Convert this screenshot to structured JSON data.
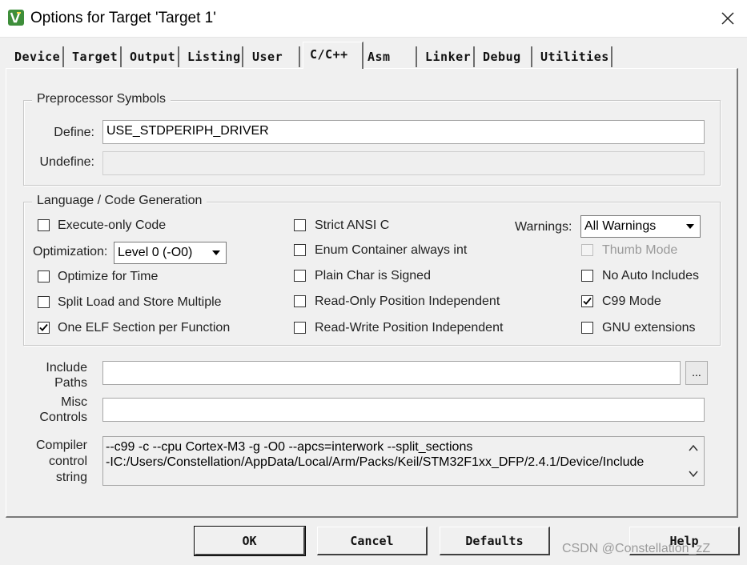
{
  "window": {
    "title": "Options for Target 'Target 1'",
    "close_glyph": "✕"
  },
  "tabs": [
    {
      "label": "Device"
    },
    {
      "label": "Target"
    },
    {
      "label": "Output"
    },
    {
      "label": "Listing"
    },
    {
      "label": "User"
    },
    {
      "label": "C/C++",
      "active": true
    },
    {
      "label": "Asm"
    },
    {
      "label": "Linker"
    },
    {
      "label": "Debug"
    },
    {
      "label": "Utilities"
    }
  ],
  "preprocessor": {
    "legend": "Preprocessor Symbols",
    "define_label": "Define:",
    "define_value": "USE_STDPERIPH_DRIVER",
    "undefine_label": "Undefine:",
    "undefine_value": ""
  },
  "language": {
    "legend": "Language / Code Generation",
    "execute_only": {
      "label": "Execute-only Code",
      "checked": false
    },
    "optimization_label": "Optimization:",
    "optimization_value": "Level 0 (-O0)",
    "optimize_for_time": {
      "label": "Optimize for Time",
      "checked": false
    },
    "split_load_store": {
      "label": "Split Load and Store Multiple",
      "checked": false
    },
    "one_elf_section": {
      "label": "One ELF Section per Function",
      "checked": true
    },
    "strict_ansi": {
      "label": "Strict ANSI C",
      "checked": false
    },
    "enum_container": {
      "label": "Enum Container always int",
      "checked": false
    },
    "plain_char_signed": {
      "label": "Plain Char is Signed",
      "checked": false
    },
    "ro_position_independent": {
      "label": "Read-Only Position Independent",
      "checked": false
    },
    "rw_position_independent": {
      "label": "Read-Write Position Independent",
      "checked": false
    },
    "warnings_label": "Warnings:",
    "warnings_value": "All Warnings",
    "thumb_mode": {
      "label": "Thumb Mode",
      "checked": false,
      "disabled": true
    },
    "no_auto_includes": {
      "label": "No Auto Includes",
      "checked": false
    },
    "c99_mode": {
      "label": "C99 Mode",
      "checked": true
    },
    "gnu_extensions": {
      "label": "GNU extensions",
      "checked": false
    }
  },
  "include_paths": {
    "label_line1": "Include",
    "label_line2": "Paths",
    "value": "",
    "browse_label": "..."
  },
  "misc_controls": {
    "label_line1": "Misc",
    "label_line2": "Controls",
    "value": ""
  },
  "compiler_string": {
    "label_line1": "Compiler",
    "label_line2": "control",
    "label_line3": "string",
    "line1": "--c99 -c --cpu Cortex-M3 -g -O0 --apcs=interwork --split_sections",
    "line2": "-IC:/Users/Constellation/AppData/Local/Arm/Packs/Keil/STM32F1xx_DFP/2.4.1/Device/Include"
  },
  "buttons": {
    "ok": "OK",
    "cancel": "Cancel",
    "defaults": "Defaults",
    "help": "Help"
  },
  "watermark": "CSDN @Constellation_zZ",
  "colors": {
    "app_icon": "#3e8e3a",
    "background": "#f0f0f0"
  },
  "icons": {
    "app": "keil-uvision-icon",
    "close": "close-icon",
    "dropdown": "chevron-down-icon",
    "check": "check-icon"
  }
}
